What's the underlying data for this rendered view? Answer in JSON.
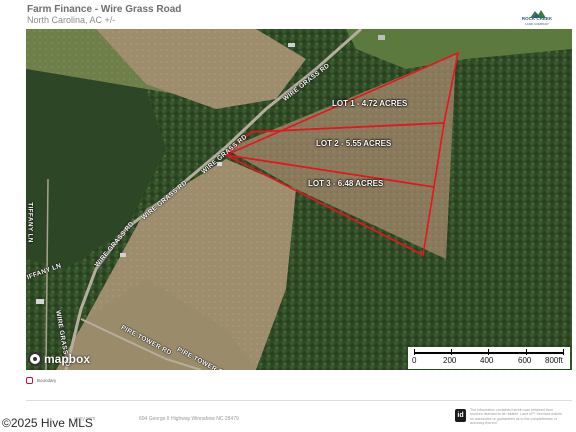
{
  "header": {
    "title": "Farm Finance - Wire Grass Road",
    "subtitle": "North Carolina,  AC +/-",
    "logo_name": "rock-creek-logo",
    "logo_text": "ROCK CREEK",
    "logo_subtext": "LAND COMPANY"
  },
  "map": {
    "roads": [
      {
        "name": "WIRE GRASS RD",
        "key": "wire-grass-rd-1"
      },
      {
        "name": "WIRE GRASS RD",
        "key": "wire-grass-rd-2"
      },
      {
        "name": "WIRE GRASS RD",
        "key": "wire-grass-rd-3"
      },
      {
        "name": "WIRE GRASS RD",
        "key": "wire-grass-rd-4"
      },
      {
        "name": "PIRE TOWER RD",
        "key": "pire-tower-rd-1"
      },
      {
        "name": "PIRE TOWER RD",
        "key": "pire-tower-rd-2"
      },
      {
        "name": "TIFFANY LN",
        "key": "tiffany-ln-1"
      },
      {
        "name": "TIFFANY LN",
        "key": "tiffany-ln-2"
      },
      {
        "name": "WIRE GRASS RD",
        "key": "wire-grass-rd-5"
      }
    ],
    "lots": [
      {
        "label": "LOT 1 - 4.72 ACRES"
      },
      {
        "label": "LOT 2 - 5.55 ACRES"
      },
      {
        "label": "LOT 3 - 6.48 ACRES"
      }
    ],
    "boundary_color": "#e8131d",
    "attribution": "mapbox",
    "scale": {
      "labels": [
        "0",
        "200",
        "400",
        "600",
        "800ft"
      ]
    }
  },
  "legend": {
    "label": "Boundary",
    "color": "#c8102e"
  },
  "footer": {
    "url_fragment": "pany.com",
    "address": "604 George II Highway Winnabow NC 28479",
    "id_logo": "id",
    "disclaimer": "The information contained herein was obtained from sources deemed to be reliable. Land id™ Services makes no warranties or guarantees as to the completeness or accuracy thereof.",
    "watermark": "©2025 Hive MLS"
  },
  "icons": {
    "mapbox": "mapbox-logo-icon",
    "id": "land-id-icon",
    "legend": "boundary-swatch-icon"
  }
}
